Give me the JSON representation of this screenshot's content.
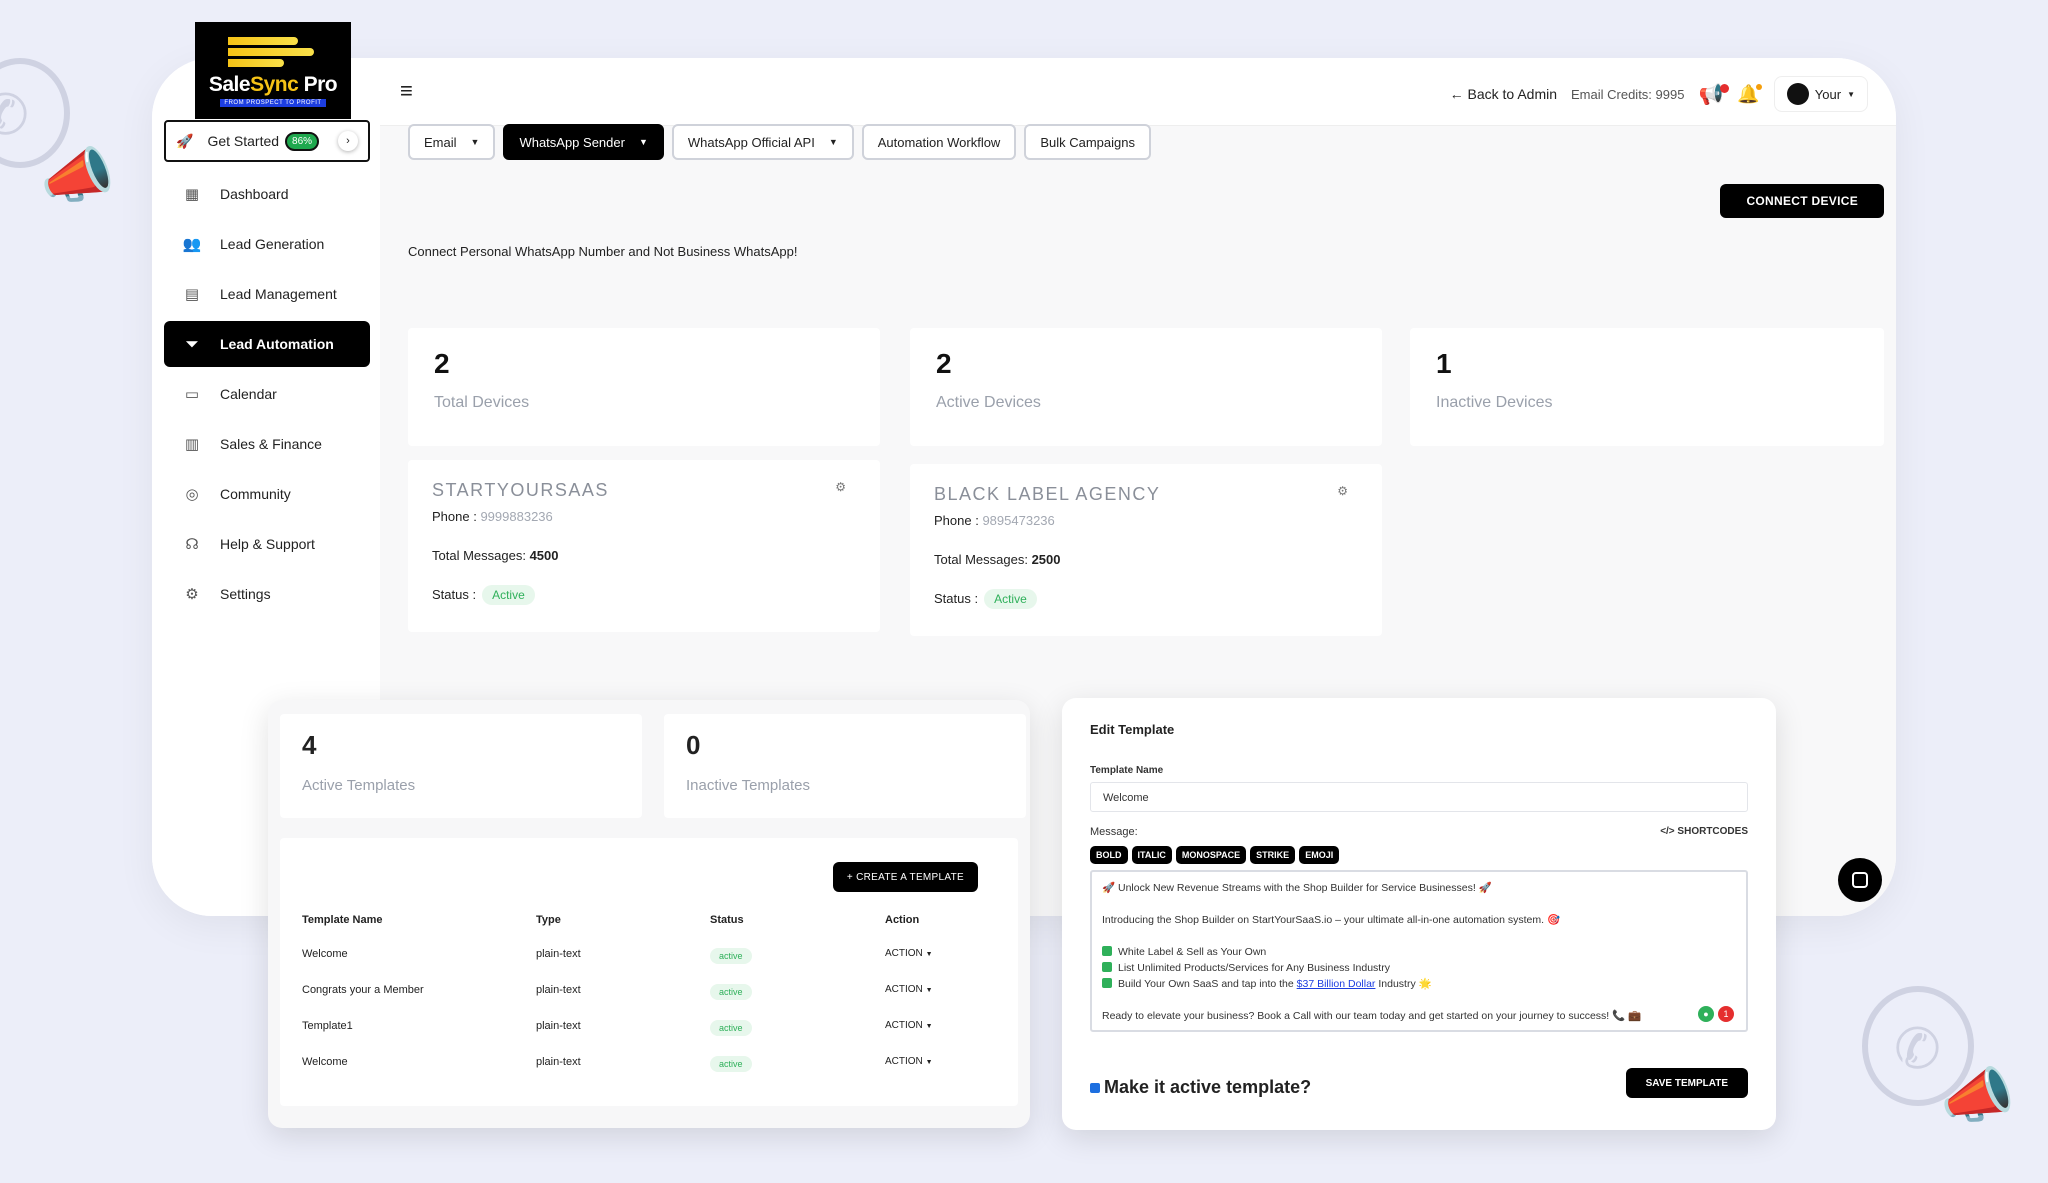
{
  "colors": {
    "accent": "#000000",
    "success": "#2fb05a",
    "brand_gold": "#f6c316",
    "background": "#eceef9"
  },
  "logo": {
    "name_a": "Sale",
    "name_b": "Sync",
    "name_c": " Pro",
    "tagline": "FROM PROSPECT TO PROFIT"
  },
  "get_started": {
    "label": "Get Started",
    "percent": "86%"
  },
  "sidebar": {
    "items": [
      {
        "label": "Dashboard",
        "icon": "dashboard-icon"
      },
      {
        "label": "Lead Generation",
        "icon": "users-icon"
      },
      {
        "label": "Lead Management",
        "icon": "contacts-icon"
      },
      {
        "label": "Lead Automation",
        "icon": "funnel-icon",
        "active": true
      },
      {
        "label": "Calendar",
        "icon": "calendar-icon"
      },
      {
        "label": "Sales & Finance",
        "icon": "chart-icon"
      },
      {
        "label": "Community",
        "icon": "community-icon"
      },
      {
        "label": "Help & Support",
        "icon": "headset-icon"
      },
      {
        "label": "Settings",
        "icon": "gear-icon"
      }
    ]
  },
  "topbar": {
    "back_admin": "Back to Admin",
    "credits": "Email Credits: 9995",
    "user": "Your"
  },
  "tabs": [
    {
      "label": "Email",
      "dropdown": true
    },
    {
      "label": "WhatsApp Sender",
      "dropdown": true,
      "active": true
    },
    {
      "label": "WhatsApp Official API",
      "dropdown": true
    },
    {
      "label": "Automation Workflow"
    },
    {
      "label": "Bulk Campaigns"
    }
  ],
  "connect_device": "CONNECT DEVICE",
  "notice": "Connect Personal WhatsApp Number and Not Business WhatsApp!",
  "stats": [
    {
      "value": "2",
      "label": "Total Devices"
    },
    {
      "value": "2",
      "label": "Active Devices"
    },
    {
      "value": "1",
      "label": "Inactive Devices"
    }
  ],
  "devices": [
    {
      "name": "STARTYOURSAAS",
      "phone_label": "Phone :",
      "phone": "9999883236",
      "messages_label": "Total Messages:",
      "messages": "4500",
      "status_label": "Status :",
      "status": "Active"
    },
    {
      "name": "BLACK LABEL AGENCY",
      "phone_label": "Phone :",
      "phone": "9895473236",
      "messages_label": "Total Messages:",
      "messages": "2500",
      "status_label": "Status :",
      "status": "Active"
    }
  ],
  "templates": {
    "stats": [
      {
        "value": "4",
        "label": "Active Templates"
      },
      {
        "value": "0",
        "label": "Inactive Templates"
      }
    ],
    "create_label": "+ CREATE A TEMPLATE",
    "headers": [
      "Template Name",
      "Type",
      "Status",
      "Action"
    ],
    "rows": [
      {
        "name": "Welcome",
        "type": "plain-text",
        "status": "active",
        "action": "ACTION"
      },
      {
        "name": "Congrats your a Member",
        "type": "plain-text",
        "status": "active",
        "action": "ACTION"
      },
      {
        "name": "Template1",
        "type": "plain-text",
        "status": "active",
        "action": "ACTION"
      },
      {
        "name": "Welcome",
        "type": "plain-text",
        "status": "active",
        "action": "ACTION"
      }
    ]
  },
  "edit_template": {
    "title": "Edit Template",
    "name_label": "Template Name",
    "name_value": "Welcome",
    "message_label": "Message:",
    "shortcodes": "</> SHORTCODES",
    "format_buttons": [
      "BOLD",
      "ITALIC",
      "MONOSPACE",
      "STRIKE",
      "EMOJI"
    ],
    "message": {
      "line1": "🚀 Unlock New Revenue Streams with the Shop Builder for Service Businesses! 🚀",
      "line2": "Introducing the Shop Builder on StartYourSaaS.io – your ultimate all-in-one automation system. 🎯",
      "check1": "White Label & Sell as Your Own",
      "check2": "List Unlimited Products/Services for Any Business Industry",
      "check3_a": "Build Your Own SaaS and tap into the ",
      "check3_link": "$37 Billion Dollar",
      "check3_b": " Industry 🌟",
      "line4": "Ready to elevate your business? Book a Call with our team today and get started on your journey to success! 📞 💼"
    },
    "active_label": "Make it active template?",
    "save_label": "SAVE TEMPLATE"
  }
}
